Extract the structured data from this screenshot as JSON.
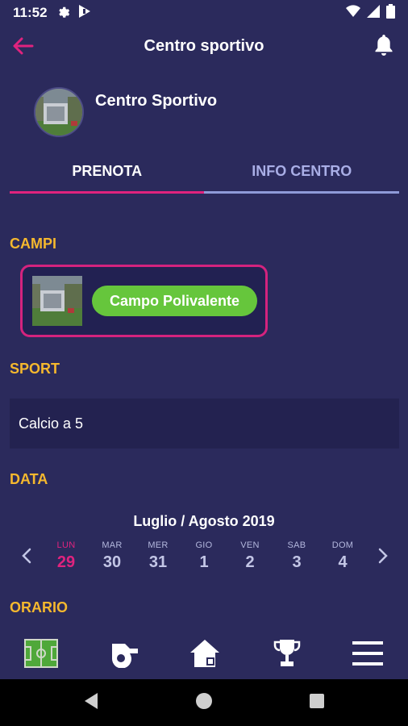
{
  "status_bar": {
    "time": "11:52",
    "icons": [
      "gear-icon",
      "media-icon",
      "wifi-icon",
      "signal-icon",
      "battery-icon"
    ]
  },
  "app_bar": {
    "title": "Centro sportivo",
    "back_icon": "arrow-left-icon",
    "notification_icon": "bell-icon"
  },
  "center": {
    "name": "Centro Sportivo"
  },
  "tabs": [
    {
      "label": "PRENOTA",
      "active": true
    },
    {
      "label": "INFO CENTRO",
      "active": false
    }
  ],
  "sections": {
    "campi": "CAMPI",
    "sport": "SPORT",
    "data": "DATA",
    "orario": "ORARIO"
  },
  "campo": {
    "label": "Campo Polivalente"
  },
  "sport": {
    "value": "Calcio a 5"
  },
  "calendar": {
    "month_label": "Luglio / Agosto 2019",
    "days": [
      {
        "name": "LUN",
        "num": "29",
        "selected": true
      },
      {
        "name": "MAR",
        "num": "30"
      },
      {
        "name": "MER",
        "num": "31"
      },
      {
        "name": "GIO",
        "num": "1"
      },
      {
        "name": "VEN",
        "num": "2"
      },
      {
        "name": "SAB",
        "num": "3"
      },
      {
        "name": "DOM",
        "num": "4"
      }
    ]
  },
  "bottom_nav": [
    "field-icon",
    "whistle-icon",
    "home-icon",
    "trophy-icon",
    "menu-icon"
  ],
  "system_nav": [
    "back-triangle-icon",
    "home-circle-icon",
    "recents-square-icon"
  ],
  "colors": {
    "background": "#2b2a5c",
    "accent_pink": "#e0237e",
    "section_yellow": "#f5b82e",
    "pill_green": "#66c63c"
  }
}
